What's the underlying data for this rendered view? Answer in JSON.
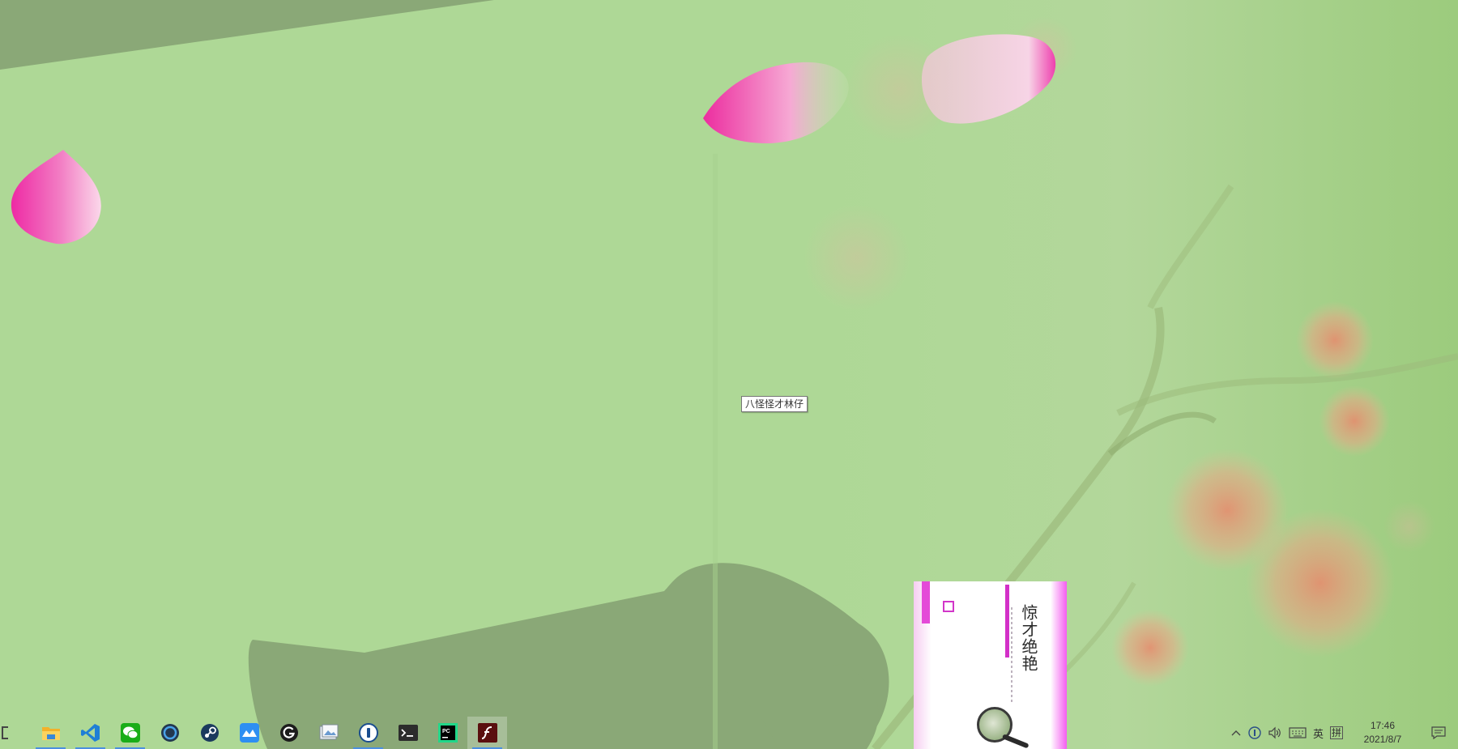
{
  "desktop": {
    "tooltip_text": "八怪怪才林仔",
    "book_cover": {
      "title": "惊才绝艳"
    }
  },
  "taskbar": {
    "apps": [
      {
        "name": "File Explorer",
        "icon": "folder-icon",
        "running": true
      },
      {
        "name": "Visual Studio Code",
        "icon": "vscode-icon",
        "running": true
      },
      {
        "name": "WeChat",
        "icon": "wechat-icon",
        "running": true
      },
      {
        "name": "Launcher",
        "icon": "blue-ring-app-icon",
        "running": false
      },
      {
        "name": "Steam",
        "icon": "steam-icon",
        "running": false
      },
      {
        "name": "Blue Mountain App",
        "icon": "mountain-app-icon",
        "running": false
      },
      {
        "name": "Logitech G Hub",
        "icon": "logitech-g-icon",
        "running": false
      },
      {
        "name": "Image Viewer",
        "icon": "photos-icon",
        "running": false
      },
      {
        "name": "1Password",
        "icon": "onepassword-icon",
        "running": true
      },
      {
        "name": "Terminal",
        "icon": "terminal-icon",
        "running": false
      },
      {
        "name": "PyCharm",
        "icon": "pycharm-icon",
        "running": false
      },
      {
        "name": "Adobe Flash",
        "icon": "flash-icon",
        "running": true,
        "active": true
      }
    ],
    "tray": {
      "chevron": "^",
      "ime_lang": "英",
      "ime_mode": "拼",
      "time": "17:46",
      "date": "2021/8/7"
    }
  },
  "colors": {
    "wallpaper_green": "#aed896",
    "petal_pink": "#ee2fa8",
    "shadow_green": "#8aa877",
    "taskbar_accent": "#4b8fe0"
  }
}
